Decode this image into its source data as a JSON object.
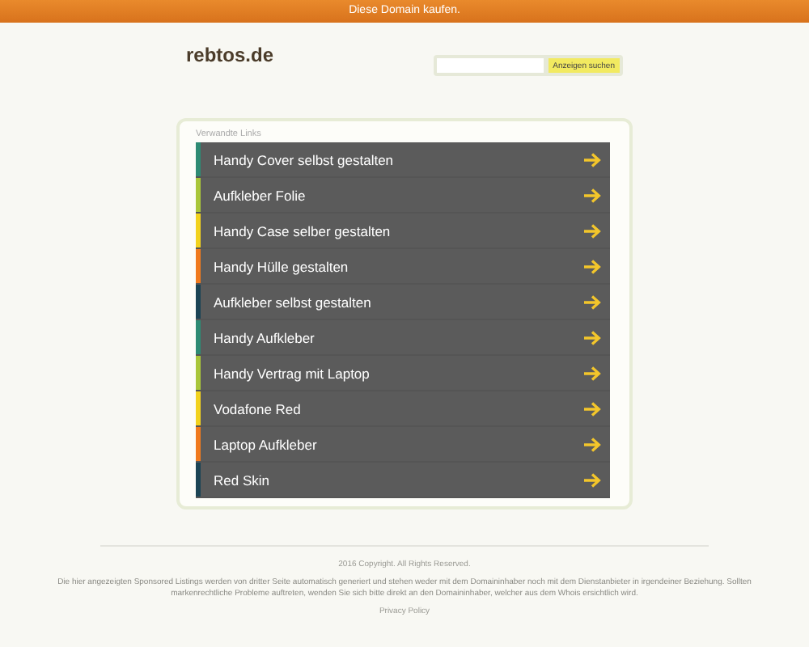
{
  "top_bar": {
    "label": "Diese Domain kaufen."
  },
  "header": {
    "site_name": "rebtos.de",
    "search": {
      "button": "Anzeigen suchen"
    }
  },
  "related": {
    "heading": "Verwandte Links",
    "links": [
      {
        "label": "Handy Cover selbst gestalten",
        "color": "#2e8b74"
      },
      {
        "label": "Aufkleber Folie",
        "color": "#a9c63a"
      },
      {
        "label": "Handy Case selber gestalten",
        "color": "#f2d21e"
      },
      {
        "label": "Handy Hülle gestalten",
        "color": "#f07a1e"
      },
      {
        "label": "Aufkleber selbst gestalten",
        "color": "#1b4455"
      },
      {
        "label": "Handy Aufkleber",
        "color": "#2e8b74"
      },
      {
        "label": "Handy Vertrag mit Laptop",
        "color": "#a9c63a"
      },
      {
        "label": "Vodafone Red",
        "color": "#f2d21e"
      },
      {
        "label": "Laptop Aufkleber",
        "color": "#f07a1e"
      },
      {
        "label": "Red Skin",
        "color": "#1b4455"
      }
    ]
  },
  "footer": {
    "copyright": "2016 Copyright. All Rights Reserved.",
    "disclaimer": "Die hier angezeigten Sponsored Listings werden von dritter Seite automatisch generiert und stehen weder mit dem Domaininhaber noch mit dem Dienstanbieter in irgendeiner Beziehung. Sollten markenrechtliche Probleme auftreten, wenden Sie sich bitte direkt an den Domaininhaber, welcher aus dem Whois ersichtlich wird.",
    "privacy": "Privacy Policy"
  }
}
